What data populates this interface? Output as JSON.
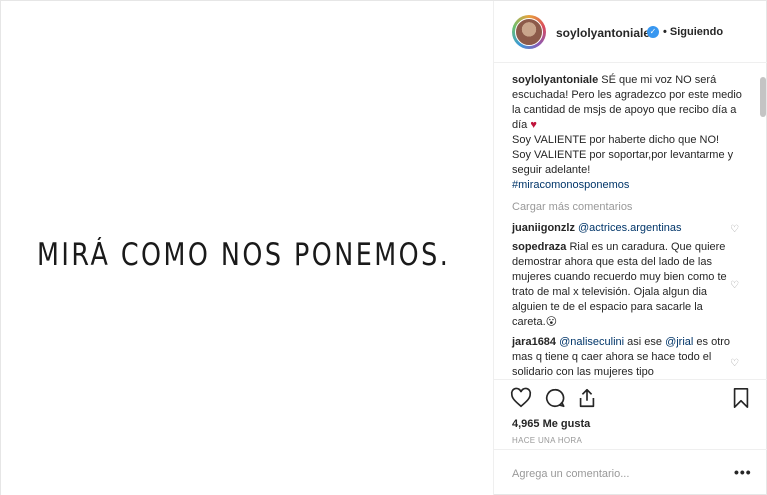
{
  "post_image": {
    "text": "MIRÁ COMO NOS PONEMOS."
  },
  "header": {
    "username": "soylolyantoniale",
    "verified_icon": "verified-badge-icon",
    "follow_status": "• Siguiendo"
  },
  "caption": {
    "username": "soylolyantoniale",
    "line1": "SÉ que mi voz NO será escuchada! Pero les agradezco por este medio la cantidad de msjs de apoyo que recibo día a día",
    "heart": "♥",
    "line2": "Soy VALIENTE por haberte dicho que NO!",
    "line3": "Soy VALIENTE por soportar,por levantarme y seguir adelante!",
    "hashtag": "#miracomonosponemos"
  },
  "load_more": "Cargar más comentarios",
  "comments": [
    {
      "username": "juaniigonzlz",
      "mention": "@actrices.argentinas",
      "text": ""
    },
    {
      "username": "sopedraza",
      "mention": "",
      "text": "Rial es un caradura. Que quiere demostrar ahora que esta del lado de las mujeres cuando recuerdo muy bien como te trato de mal x televisión. Ojala algun dia alguien te de el espacio para sacarle la careta.😮"
    },
    {
      "username": "jara1684",
      "mention": "@naliseculini",
      "text_a": " asi ese ",
      "mention2": "@jrial",
      "text": " es otro mas q tiene q caer ahora se hace todo el solidario con las mujeres tipo"
    }
  ],
  "actions": {
    "like_icon": "heart-outline-icon",
    "comment_icon": "comment-bubble-icon",
    "share_icon": "share-icon",
    "save_icon": "bookmark-icon"
  },
  "likes": "4,965 Me gusta",
  "time": "HACE UNA HORA",
  "comment_box": {
    "placeholder": "Agrega un comentario...",
    "more_icon": "more-options-icon"
  },
  "colors": {
    "link": "#003569",
    "verified": "#3897f0",
    "muted": "#999999",
    "heart": "#c0143c"
  }
}
